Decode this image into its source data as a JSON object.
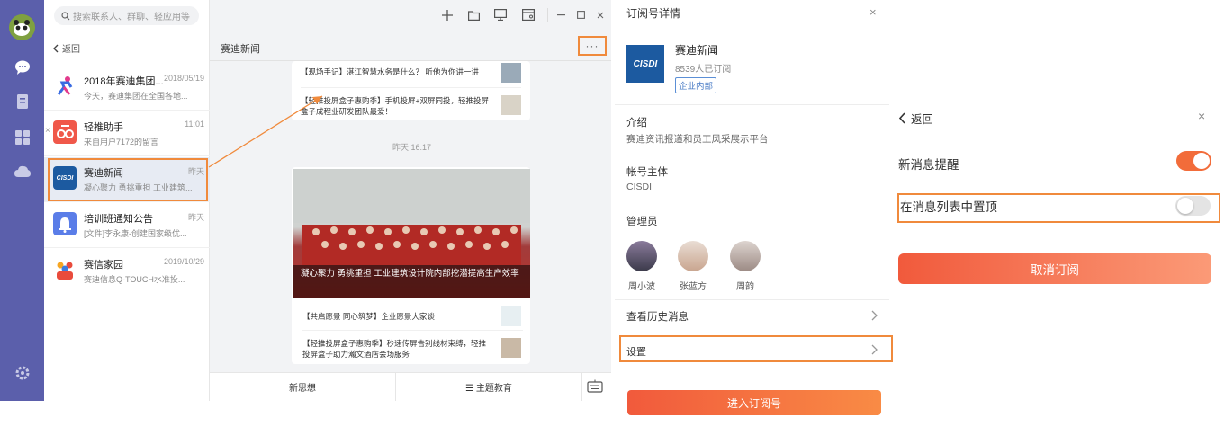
{
  "search": {
    "placeholder": "搜索联系人、群聊、轻应用等"
  },
  "nav": {
    "back_label": "返回"
  },
  "conversations": [
    {
      "name": "2018年赛迪集团...",
      "time": "2018/05/19",
      "preview": "今天，赛迪集团在全国各地...",
      "icon": "runner-icon",
      "color": "#ffffff"
    },
    {
      "name": "轻推助手",
      "time": "11:01",
      "preview": "来自用户7172的留言",
      "icon": "helper-icon",
      "color": "#f0584a"
    },
    {
      "name": "赛迪新闻",
      "time": "昨天",
      "preview": "凝心聚力 勇挑重担 工业建筑...",
      "icon": "cisdi-logo",
      "color": "#1c5aa0"
    },
    {
      "name": "培训班通知公告",
      "time": "昨天",
      "preview": "[文件]李永康-创建国家级优...",
      "icon": "bell-icon",
      "color": "#5a7de8"
    },
    {
      "name": "赛信家园",
      "time": "2019/10/29",
      "preview": "赛迪信息Q-TOUCH水准投...",
      "icon": "people-icon",
      "color": "#ffffff"
    }
  ],
  "chat": {
    "title": "赛迪新闻",
    "more": "···",
    "card_top": [
      "【现场手记】湛江智慧水务是什么？ 听他为你讲一讲",
      "【轻推投屏盒子惠购季】手机投屏+双屏同投，轻推投屏盒子成程业研发团队最爱！"
    ],
    "day_label": "昨天 16:17",
    "hero_caption": "凝心聚力 勇挑重担 工业建筑设计院内部挖潜提高生产效率",
    "card_bottom": [
      "【共启愿景 同心筑梦】企业愿景大家谈",
      "【轻推投屏盒子惠购季】秒速传屏告别线材束缚，轻推投屏盒子助力瀚文酒店会场服务"
    ],
    "menu": [
      "新思想",
      "☰ 主题教育"
    ]
  },
  "detail": {
    "title": "订阅号详情",
    "close": "×",
    "logo_text": "CISDI",
    "name": "赛迪新闻",
    "subscribers": "8539人已订阅",
    "tag": "企业内部",
    "intro_label": "介绍",
    "intro_value": "赛迪资讯报道和员工风采展示平台",
    "owner_label": "帐号主体",
    "owner_value": "CISDI",
    "admins_label": "管理员",
    "admins": [
      "周小波",
      "张蓝方",
      "周韵"
    ],
    "history_label": "查看历史消息",
    "settings_label": "设置",
    "enter_button": "进入订阅号"
  },
  "settings": {
    "back_label": "返回",
    "close": "×",
    "notify_label": "新消息提醒",
    "notify_on": true,
    "pin_label": "在消息列表中置顶",
    "pin_on": false,
    "unsubscribe_button": "取消订阅"
  },
  "colors": {
    "rail": "#5b5fab",
    "highlight": "#f08a3c",
    "toggle_on": "#f26c3a"
  }
}
